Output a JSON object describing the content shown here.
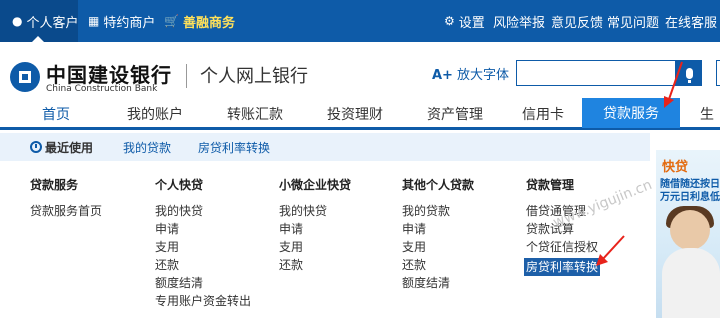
{
  "topbar": {
    "left": [
      {
        "icon": "person-icon",
        "label": "个人客户",
        "active": true
      },
      {
        "icon": "store-icon",
        "label": "特约商户"
      },
      {
        "icon": "cart-icon",
        "label": "善融商务"
      }
    ],
    "right": [
      {
        "icon": "gear-icon",
        "label": "设置"
      },
      {
        "label": "风险举报"
      },
      {
        "label": "意见反馈"
      },
      {
        "label": "常见问题"
      },
      {
        "label": "在线客服"
      }
    ]
  },
  "header": {
    "logo_cn": "中国建设银行",
    "logo_en": "China Construction Bank",
    "site_name": "个人网上银行",
    "font_button_icon": "A+",
    "font_button_label": "放大字体",
    "search_value": ""
  },
  "mainnav": [
    {
      "label": "首页"
    },
    {
      "label": "我的账户"
    },
    {
      "label": "转账汇款"
    },
    {
      "label": "投资理财"
    },
    {
      "label": "资产管理"
    },
    {
      "label": "信用卡"
    },
    {
      "label": "贷款服务",
      "current": true
    },
    {
      "label": "生"
    }
  ],
  "subnav": {
    "recent_label": "最近使用",
    "items": [
      "我的贷款",
      "房贷利率转换"
    ]
  },
  "menu": {
    "columns": [
      {
        "title": "贷款服务",
        "links": [
          "贷款服务首页"
        ]
      },
      {
        "title": "个人快贷",
        "links": [
          "我的快贷",
          "申请",
          "支用",
          "还款",
          "额度结清",
          "专用账户资金转出"
        ]
      },
      {
        "title": "小微企业快贷",
        "links": [
          "我的快贷",
          "申请",
          "支用",
          "还款"
        ]
      },
      {
        "title": "其他个人贷款",
        "links": [
          "我的贷款",
          "申请",
          "支用",
          "还款",
          "额度结清"
        ]
      },
      {
        "title": "贷款管理",
        "links": [
          "借贷通管理",
          "贷款试算",
          "个贷征信授权",
          "房贷利率转换"
        ],
        "highlighted": "房贷利率转换"
      }
    ]
  },
  "banner": {
    "title": "快贷",
    "line1": "随借随还按日",
    "line2": "万元日利息低"
  },
  "watermark": "www.yigujin.cn",
  "colors": {
    "brand_blue": "#0e5ba8",
    "nav_active": "#1f84e0",
    "subnav_bg": "#e9f2fb",
    "annotation_red": "#e8231b"
  }
}
